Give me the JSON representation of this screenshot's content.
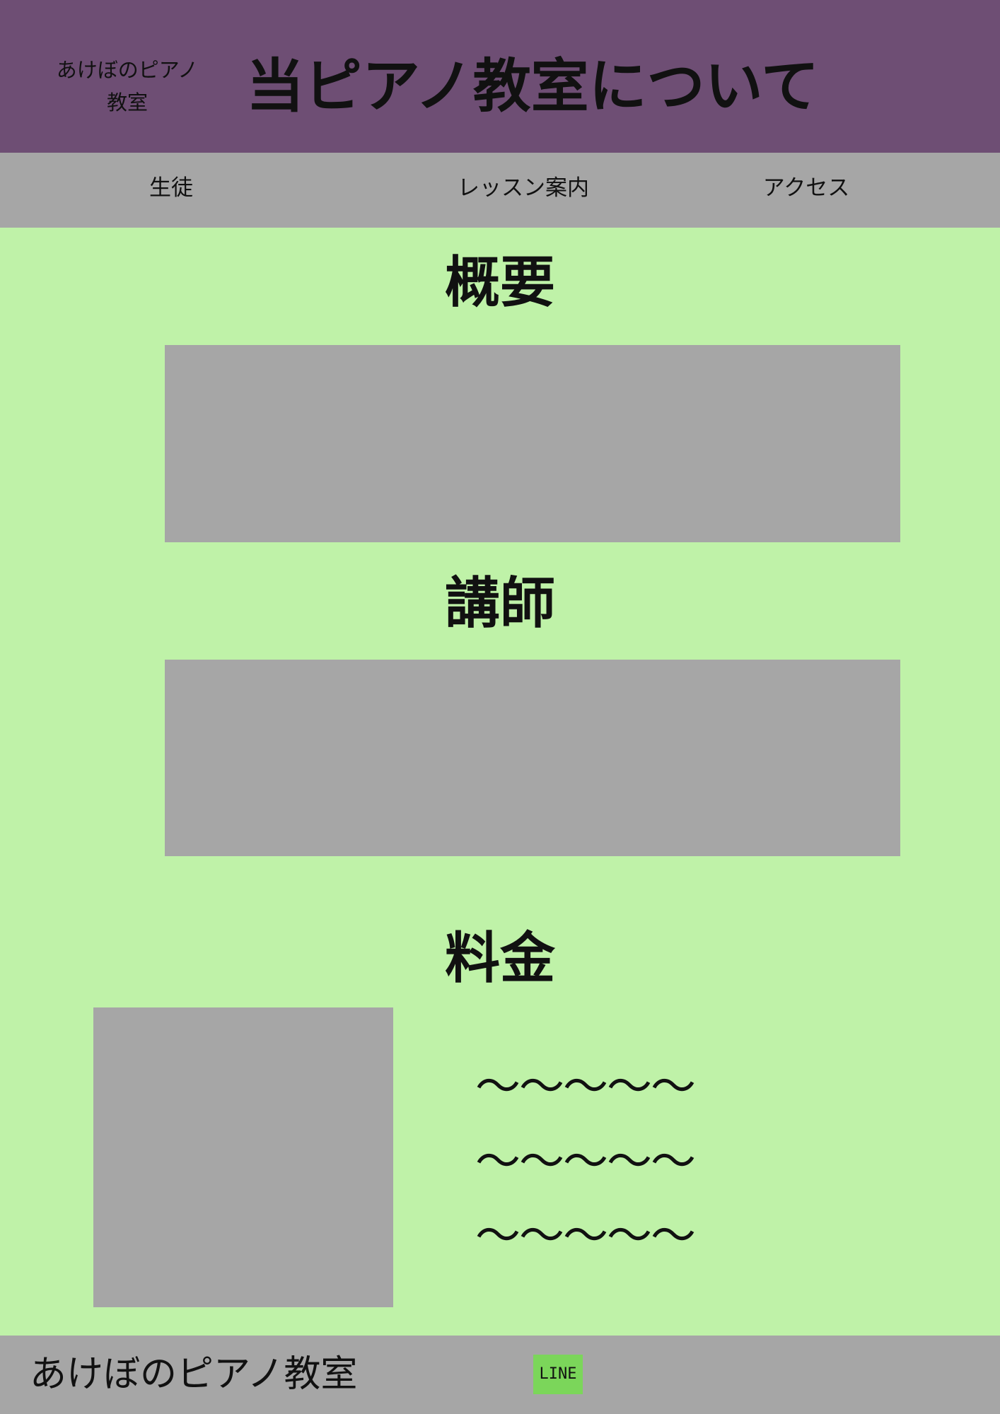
{
  "header": {
    "logo_line1": "あけぼのピアノ",
    "logo_line2": "教室",
    "title": "当ピアノ教室について"
  },
  "nav": {
    "items": [
      {
        "label": "生徒"
      },
      {
        "label": "レッスン案内"
      },
      {
        "label": "アクセス"
      }
    ]
  },
  "sections": {
    "overview_title": "概要",
    "instructor_title": "講師",
    "fees_title": "料金",
    "fee_lines": [
      "〜〜〜〜〜",
      "〜〜〜〜〜",
      "〜〜〜〜〜"
    ]
  },
  "footer": {
    "name": "あけぼのピアノ教室",
    "line_label": "LINE"
  },
  "colors": {
    "header_bg": "#6e4e74",
    "nav_bg": "#a6a6a6",
    "page_bg": "#bff2a8",
    "placeholder": "#a6a6a6",
    "line_button": "#7bd65a"
  }
}
